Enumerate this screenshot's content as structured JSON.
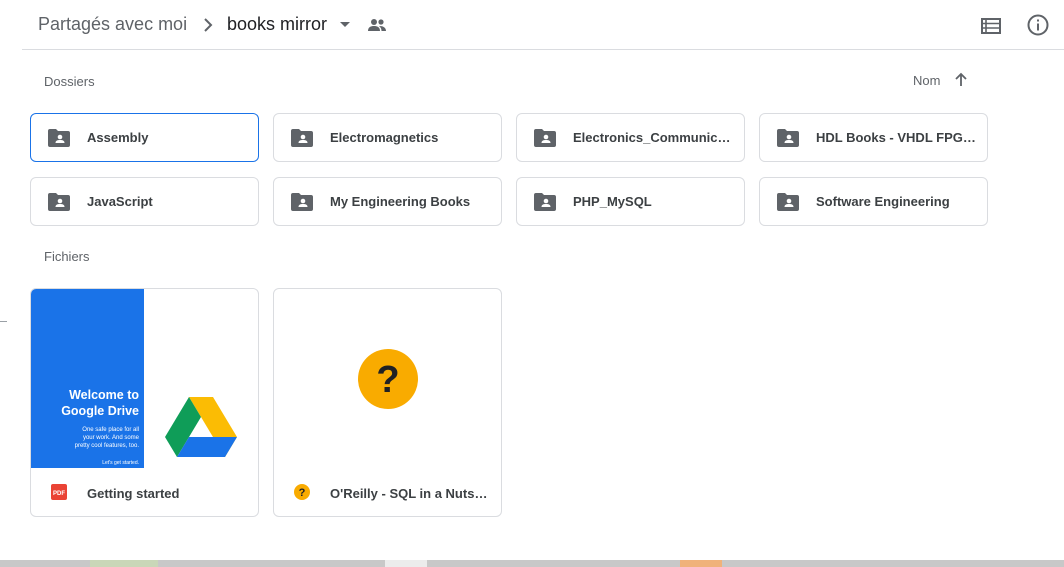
{
  "header": {
    "breadcrumb_root": "Partagés avec moi",
    "current_folder": "books mirror",
    "icons": {
      "separator": "chevron-right-icon",
      "dropdown": "caret-down-icon",
      "shared": "people-icon",
      "view": "list-view-icon",
      "info": "info-icon"
    }
  },
  "sections": {
    "folders_label": "Dossiers",
    "files_label": "Fichiers"
  },
  "sort": {
    "label": "Nom",
    "direction": "ascending",
    "icon": "arrow-up-icon"
  },
  "folders": [
    {
      "name": "Assembly",
      "selected": true,
      "icon": "shared-folder-icon"
    },
    {
      "name": "Electromagnetics",
      "selected": false,
      "icon": "shared-folder-icon"
    },
    {
      "name": "Electronics_Communicati...",
      "selected": false,
      "icon": "shared-folder-icon"
    },
    {
      "name": "HDL Books - VHDL FPGA ...",
      "selected": false,
      "icon": "shared-folder-icon"
    },
    {
      "name": "JavaScript",
      "selected": false,
      "icon": "shared-folder-icon"
    },
    {
      "name": "My Engineering Books",
      "selected": false,
      "icon": "shared-folder-icon"
    },
    {
      "name": "PHP_MySQL",
      "selected": false,
      "icon": "shared-folder-icon"
    },
    {
      "name": "Software Engineering",
      "selected": false,
      "icon": "shared-folder-icon"
    }
  ],
  "files": [
    {
      "name": "Getting started",
      "type_icon": "pdf-icon",
      "type_label": "PDF",
      "thumbnail": {
        "title": "Welcome to\nGoogle Drive",
        "subtitle": "One safe place for all\nyour work. And some\npretty cool features, too.",
        "cta": "Let's get started.",
        "logo": "google-drive-logo"
      }
    },
    {
      "name": "O'Reilly - SQL in a Nutshel...",
      "type_icon": "unknown-file-icon",
      "thumbnail": {
        "glyph": "?"
      }
    }
  ],
  "colors": {
    "accent": "#1a73e8",
    "folder_icon": "#5f6368",
    "unknown_icon": "#f9ab00",
    "pdf_red": "#ea4335"
  }
}
